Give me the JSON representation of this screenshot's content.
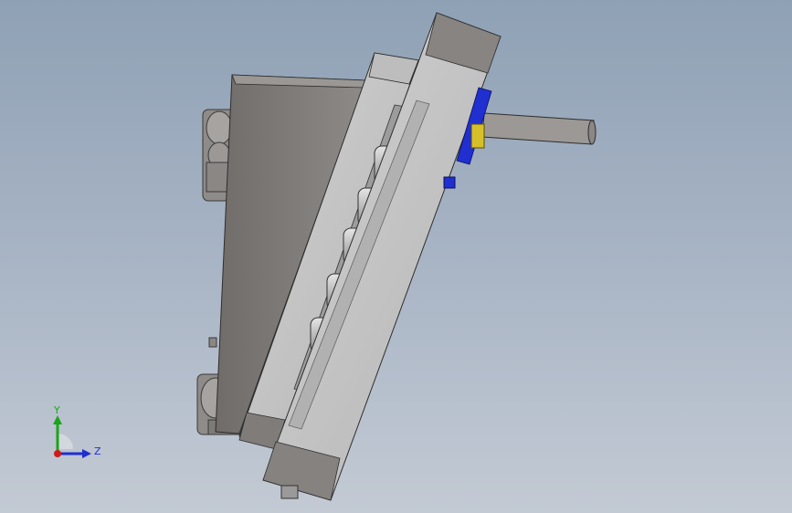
{
  "viewport": {
    "background_top": "#8fa1b5",
    "background_bottom": "#c3cad4"
  },
  "model": {
    "part_colors": {
      "steel_light": "#c7c7c7",
      "steel_mid": "#a9a9a9",
      "steel_dark": "#7d7a78",
      "fastener_blue": "#1f2fd0",
      "fastener_yellow": "#d6c02a"
    }
  },
  "triad": {
    "y_label": "Y",
    "z_label": "Z",
    "y_color": "#1aa51a",
    "z_color": "#1f2fd0",
    "x_color": "#d01a1a",
    "arc_color": "#d7dbe0"
  }
}
